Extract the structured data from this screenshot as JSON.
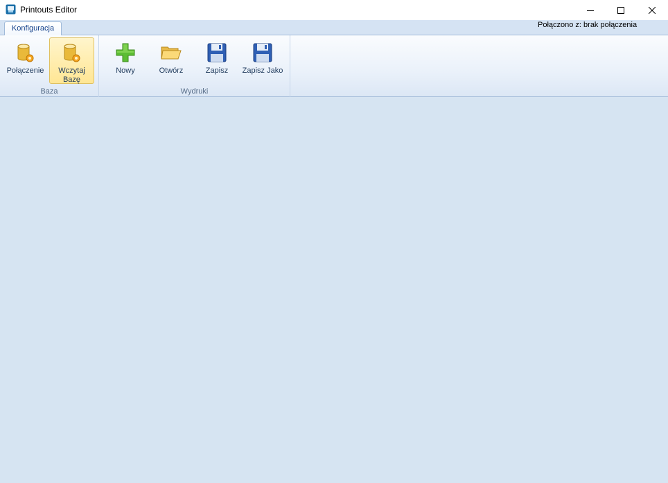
{
  "window": {
    "title": "Printouts Editor",
    "minimize_glyph": "—",
    "maximize_glyph": "☐",
    "close_glyph": "✕"
  },
  "ribbon": {
    "tabs": [
      {
        "label": "Konfiguracja",
        "active": true
      }
    ],
    "status_text": "Połączono z: brak połączenia",
    "groups": [
      {
        "label": "Baza",
        "buttons": [
          {
            "label": "Połączenie",
            "icon": "database-gear-icon"
          },
          {
            "label": "Wczytaj Bazę",
            "label_line1": "Wczytaj",
            "label_line2": "Bazę",
            "icon": "database-gear-icon",
            "state": "hover"
          }
        ]
      },
      {
        "label": "Wydruki",
        "buttons": [
          {
            "label": "Nowy",
            "icon": "plus-icon"
          },
          {
            "label": "Otwórz",
            "icon": "folder-open-icon"
          },
          {
            "label": "Zapisz",
            "icon": "floppy-disk-icon"
          },
          {
            "label": "Zapisz Jako",
            "icon": "floppy-disk-icon"
          }
        ]
      }
    ]
  },
  "colors": {
    "workspace_bg": "#d6e4f2",
    "hover_bg": "#ffe694",
    "text_accent": "#15428b"
  }
}
